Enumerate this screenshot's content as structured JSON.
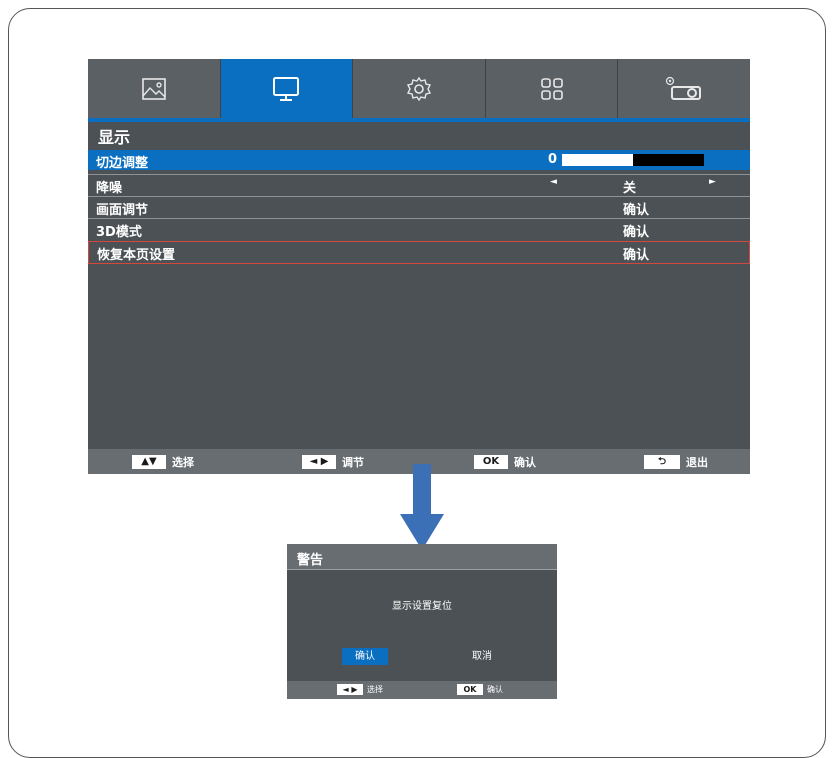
{
  "tabs": [
    {
      "icon": "picture-icon",
      "active": false
    },
    {
      "icon": "display-icon",
      "active": true
    },
    {
      "icon": "settings-gear-icon",
      "active": false
    },
    {
      "icon": "apps-grid-icon",
      "active": false
    },
    {
      "icon": "projector-settings-icon",
      "active": false
    }
  ],
  "menu": {
    "title": "显示",
    "items": [
      {
        "label": "切边调整",
        "value": "0",
        "slider_fraction": 0.5
      },
      {
        "label": "降噪",
        "value": "关"
      },
      {
        "label": "画面调节",
        "value": "确认"
      },
      {
        "label": "3D模式",
        "value": "确认"
      },
      {
        "label": "恢复本页设置",
        "value": "确认"
      }
    ],
    "arrows": {
      "left": "◄",
      "right": "►"
    }
  },
  "hints": [
    {
      "key": "▲▼",
      "label": "选择"
    },
    {
      "key": "◄ ▶",
      "label": "调节"
    },
    {
      "key": "OK",
      "label": "确认"
    },
    {
      "key": "⮌",
      "label": "退出"
    }
  ],
  "dialog": {
    "title": "警告",
    "message": "显示设置复位",
    "confirm": "确认",
    "cancel": "取消",
    "hints": [
      {
        "key": "◄ ▶",
        "label": "选择"
      },
      {
        "key": "OK",
        "label": "确认"
      }
    ]
  },
  "colors": {
    "accent": "#0b6fc1",
    "panel": "#4b5154",
    "bar": "#676d71",
    "outline": "#d4473f",
    "arrow": "#3b6fb6"
  }
}
